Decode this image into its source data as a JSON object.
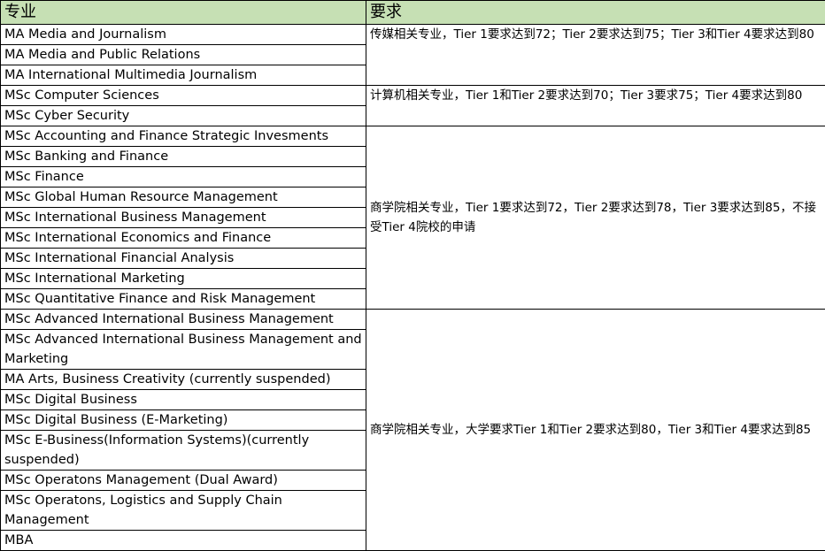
{
  "header": {
    "col_major": "专业",
    "col_requirement": "要求"
  },
  "groups": [
    {
      "majors": [
        "MA Media and Journalism",
        "MA Media and Public Relations",
        "MA International Multimedia Journalism"
      ],
      "requirement": "传媒相关专业，Tier 1要求达到72；Tier 2要求达到75；Tier 3和Tier 4要求达到80"
    },
    {
      "majors": [
        "MSc Computer Sciences",
        "MSc Cyber Security"
      ],
      "requirement": "计算机相关专业，Tier 1和Tier 2要求达到70；Tier 3要求75；Tier 4要求达到80"
    },
    {
      "majors": [
        "MSc Accounting and Finance Strategic Invesments",
        "MSc Banking and Finance",
        "MSc Finance",
        "MSc Global Human Resource Management",
        "MSc International Business Management",
        "MSc International Economics and Finance",
        "MSc International Financial Analysis",
        "MSc International Marketing",
        "MSc Quantitative Finance and Risk Management"
      ],
      "requirement": "商学院相关专业，Tier 1要求达到72，Tier 2要求达到78，Tier 3要求达到85，不接受Tier 4院校的申请"
    },
    {
      "majors": [
        "MSc Advanced International Business Management",
        "MSc Advanced International Business Management and Marketing",
        "MA Arts, Business Creativity (currently suspended)",
        "MSc Digital Business",
        "MSc Digital Business (E-Marketing)",
        "MSc E-Business(Information Systems)(currently suspended)",
        "MSc Operatons Management (Dual Award)",
        "MSc Operatons, Logistics and Supply Chain Management",
        "MBA"
      ],
      "requirement": "商学院相关专业，大学要求Tier 1和Tier 2要求达到80，Tier 3和Tier 4要求达到85"
    }
  ]
}
